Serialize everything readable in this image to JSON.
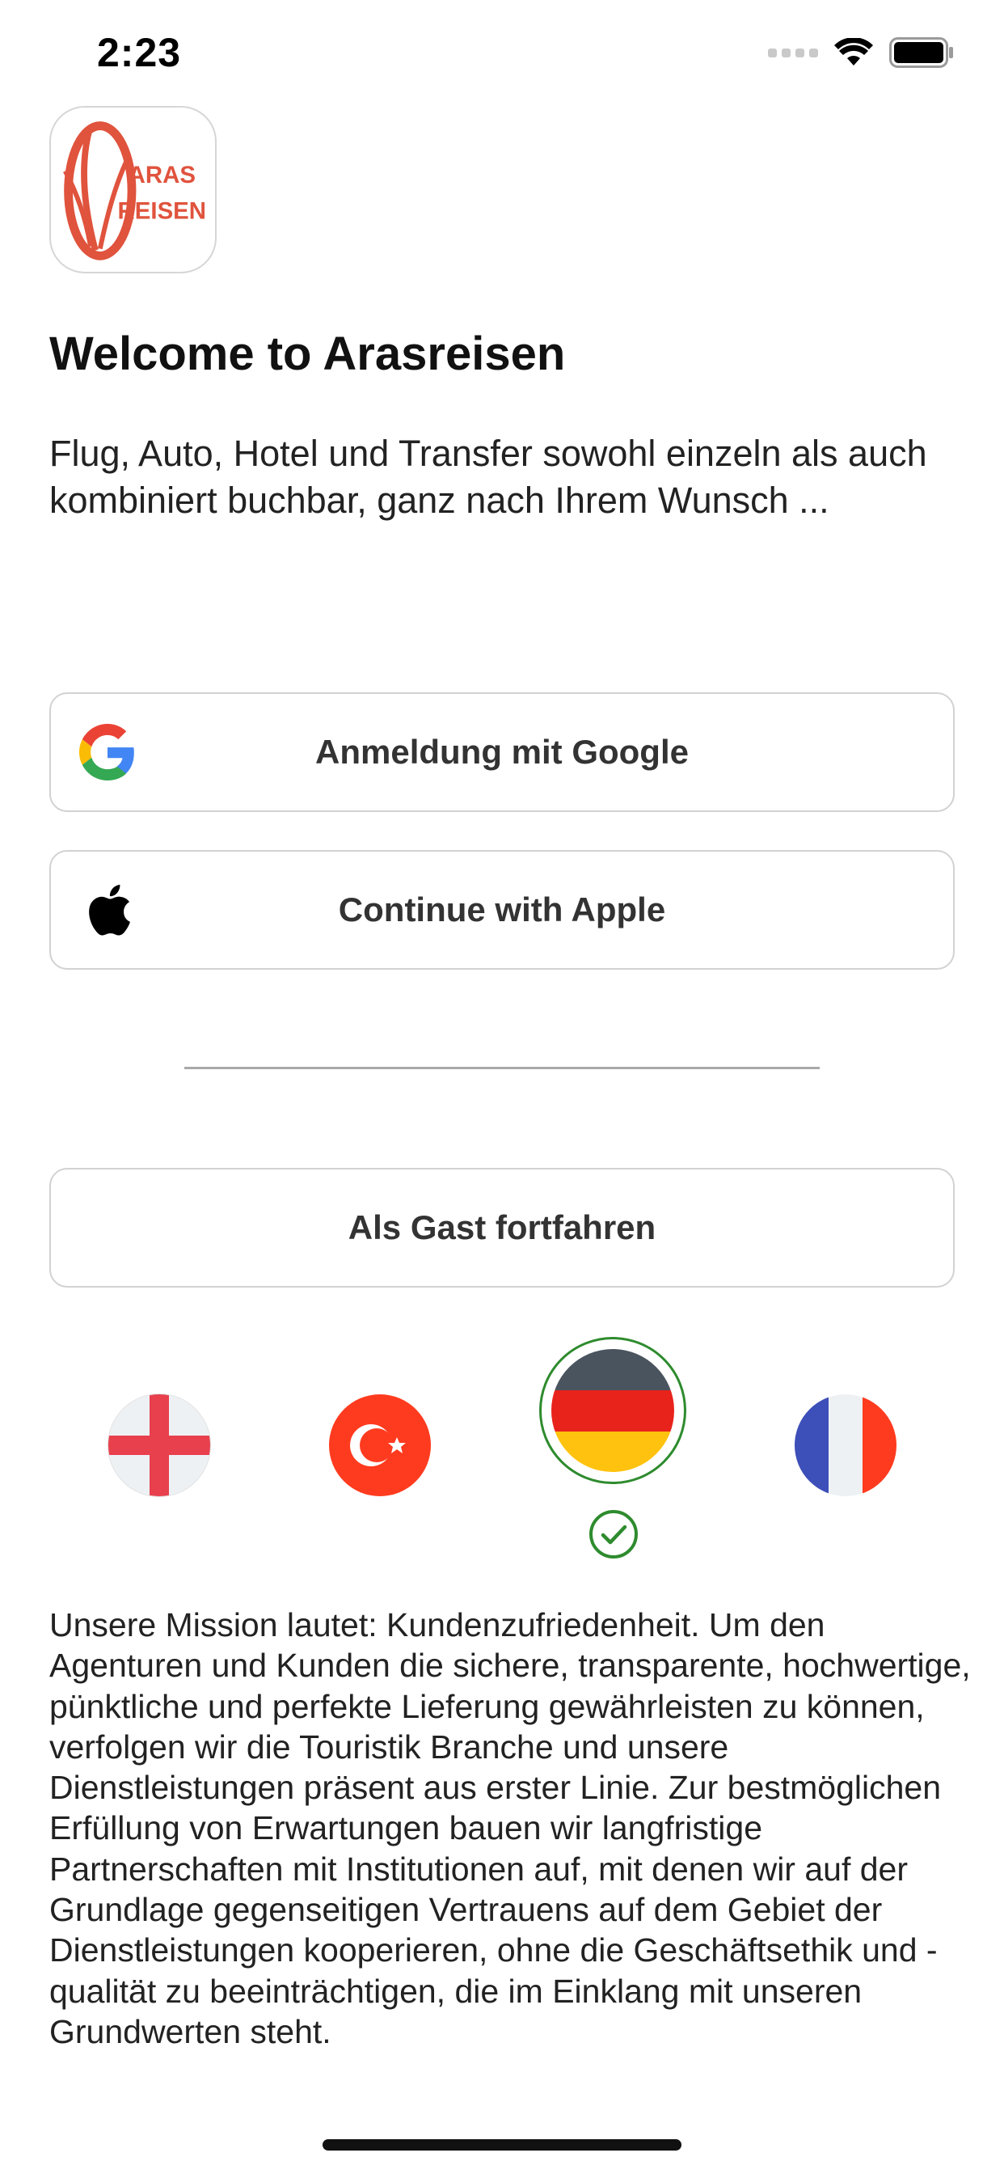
{
  "status_bar": {
    "time": "2:23",
    "icons": [
      "cellular-signal-icon",
      "wifi-icon",
      "battery-icon"
    ]
  },
  "logo": {
    "line1": "ARAS",
    "line2": "REISEN",
    "brand_color": "#e0533d"
  },
  "welcome": {
    "title": "Welcome to Arasreisen",
    "subtitle": "Flug, Auto, Hotel und Transfer sowohl einzeln als auch kombiniert buchbar, ganz nach Ihrem Wunsch ..."
  },
  "auth": {
    "google_label": "Anmeldung mit Google",
    "apple_label": "Continue with Apple",
    "guest_label": "Als Gast fortfahren"
  },
  "languages": {
    "options": [
      "english-flag",
      "turkish-flag",
      "german-flag",
      "french-flag"
    ],
    "selected": "german-flag",
    "selected_color": "#2e8b2e"
  },
  "mission_text": "Unsere Mission lautet: Kundenzufriedenheit. Um den Agenturen und Kunden die sichere, transparente, hochwertige, pünktliche und perfekte Lieferung gewährleisten zu können, verfolgen wir die Touristik Branche und unsere Dienstleistungen präsent aus erster Linie. Zur bestmöglichen Erfüllung von Erwartungen bauen wir langfristige Partnerschaften mit Institutionen auf, mit denen wir auf der Grundlage gegenseitigen Vertrauens auf dem Gebiet der Dienstleistungen kooperieren, ohne die Geschäftsethik und -qualität zu beeinträchtigen, die im Einklang mit unseren Grundwerten steht."
}
